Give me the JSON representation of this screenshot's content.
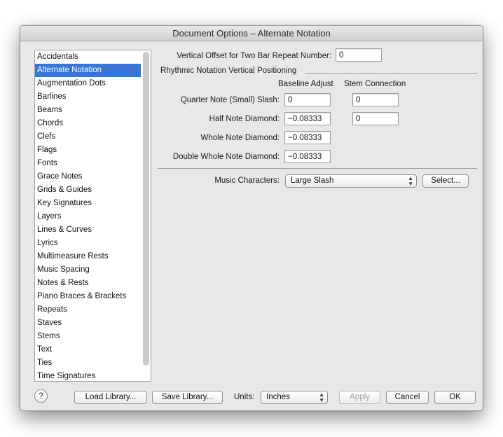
{
  "window": {
    "title": "Document Options – Alternate Notation"
  },
  "sidebar": {
    "items": [
      {
        "label": "Accidentals"
      },
      {
        "label": "Alternate Notation"
      },
      {
        "label": "Augmentation Dots"
      },
      {
        "label": "Barlines"
      },
      {
        "label": "Beams"
      },
      {
        "label": "Chords"
      },
      {
        "label": "Clefs"
      },
      {
        "label": "Flags"
      },
      {
        "label": "Fonts"
      },
      {
        "label": "Grace Notes"
      },
      {
        "label": "Grids & Guides"
      },
      {
        "label": "Key Signatures"
      },
      {
        "label": "Layers"
      },
      {
        "label": "Lines & Curves"
      },
      {
        "label": "Lyrics"
      },
      {
        "label": "Multimeasure Rests"
      },
      {
        "label": "Music Spacing"
      },
      {
        "label": "Notes & Rests"
      },
      {
        "label": "Piano Braces & Brackets"
      },
      {
        "label": "Repeats"
      },
      {
        "label": "Staves"
      },
      {
        "label": "Stems"
      },
      {
        "label": "Text"
      },
      {
        "label": "Ties"
      },
      {
        "label": "Time Signatures"
      }
    ],
    "selected_index": 1
  },
  "main": {
    "two_bar_label": "Vertical Offset for Two Bar Repeat Number:",
    "two_bar_value": "0",
    "section_title": "Rhythmic Notation Vertical Positioning",
    "col_baseline": "Baseline Adjust",
    "col_stem": "Stem Connection",
    "rows": [
      {
        "label": "Quarter Note (Small) Slash:",
        "baseline": "0",
        "stem": "0"
      },
      {
        "label": "Half Note Diamond:",
        "baseline": "−0.08333",
        "stem": "0"
      },
      {
        "label": "Whole Note Diamond:",
        "baseline": "−0.08333"
      },
      {
        "label": "Double Whole Note Diamond:",
        "baseline": "−0.08333"
      }
    ],
    "music_chars_label": "Music Characters:",
    "music_chars_value": "Large Slash",
    "select_button": "Select..."
  },
  "footer": {
    "help": "?",
    "load_library": "Load Library...",
    "save_library": "Save Library...",
    "units_label": "Units:",
    "units_value": "Inches",
    "apply": "Apply",
    "cancel": "Cancel",
    "ok": "OK"
  },
  "colors": {
    "selection": "#3875d7"
  }
}
